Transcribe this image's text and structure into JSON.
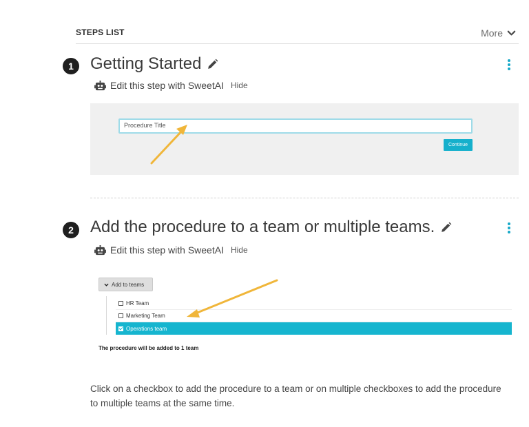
{
  "header": {
    "title": "STEPS LIST",
    "more_label": "More"
  },
  "steps": [
    {
      "number": "1",
      "title": "Getting Started",
      "ai_label": "Edit this step with SweetAI",
      "hide_label": "Hide",
      "screenshot": {
        "input_value": "Procedure Title",
        "button_label": "Continue"
      }
    },
    {
      "number": "2",
      "title": "Add the procedure to a team or multiple teams.",
      "ai_label": "Edit this step with SweetAI",
      "hide_label": "Hide",
      "screenshot": {
        "dropdown_label": "Add to teams",
        "teams": [
          {
            "label": "HR Team",
            "checked": false
          },
          {
            "label": "Marketing Team",
            "checked": false
          },
          {
            "label": "Operations team",
            "checked": true
          }
        ],
        "summary": "The procedure will be added to 1 team"
      },
      "description": "Click on a checkbox to add the procedure to a team or on multiple checkboxes to add the procedure to multiple teams at the same time."
    }
  ],
  "colors": {
    "accent": "#16b0cc",
    "arrow": "#f0b63a",
    "step_badge": "#1f1f1f"
  }
}
